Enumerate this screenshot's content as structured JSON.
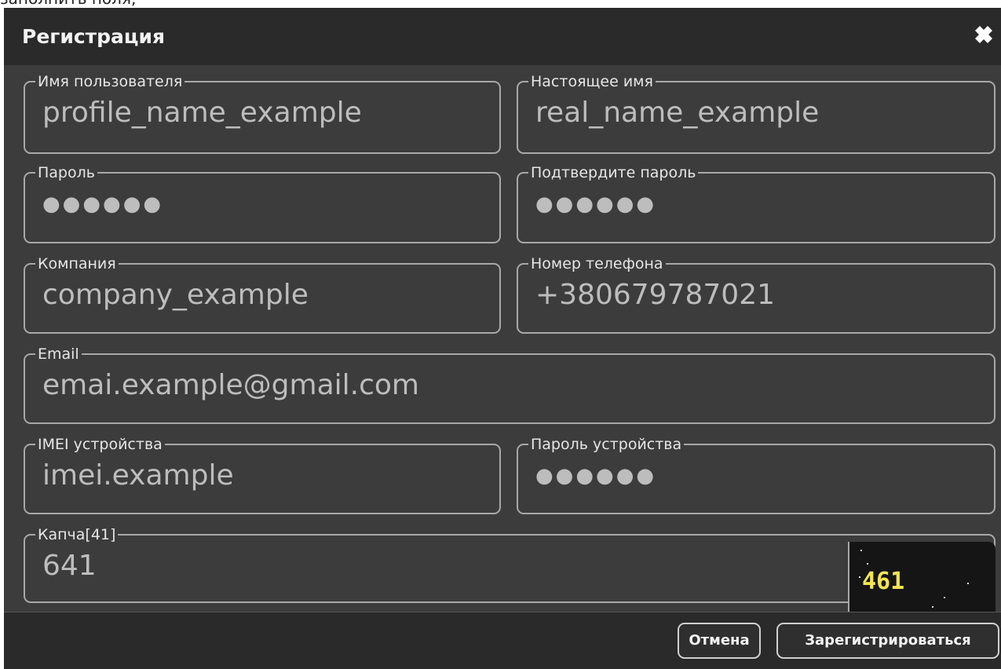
{
  "top_text": "заполнить поля,",
  "dialog": {
    "title": "Регистрация",
    "close_icon": "close-icon"
  },
  "fields": {
    "username": {
      "label": "Имя пользователя",
      "value": "profile_name_example"
    },
    "real_name": {
      "label": "Настоящее имя",
      "value": "real_name_example"
    },
    "password": {
      "label": "Пароль",
      "value": "●●●●●●"
    },
    "confirm_password": {
      "label": "Подтвердите пароль",
      "value": "●●●●●●"
    },
    "company": {
      "label": "Компания",
      "value": "company_example"
    },
    "phone": {
      "label": "Номер телефона",
      "value": "+380679787021"
    },
    "email": {
      "label": "Email",
      "value": "emai.example@gmail.com"
    },
    "imei": {
      "label": "IMEI устройства",
      "value": "imei.example"
    },
    "device_password": {
      "label": "Пароль устройства",
      "value": "●●●●●●"
    },
    "captcha": {
      "label": "Капча[41]",
      "value": "641",
      "image_code": "461"
    }
  },
  "buttons": {
    "cancel": "Отмена",
    "register": "Зарегистрироваться"
  },
  "colors": {
    "background": "#3c3c3c",
    "header": "#2a2a2a",
    "captcha_text": "#f2e64a"
  }
}
